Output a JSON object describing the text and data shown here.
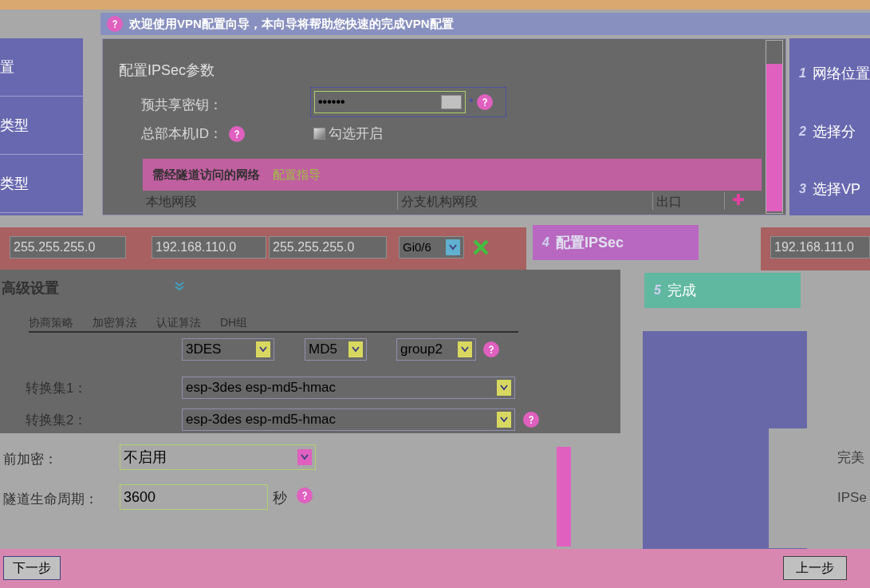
{
  "window": {
    "title": "欢迎使用VPN配置向导，本向导将帮助您快速的完成VPN配置"
  },
  "sidebar": {
    "items": [
      {
        "label": "置"
      },
      {
        "label": "类型"
      },
      {
        "label": "类型"
      }
    ]
  },
  "form": {
    "heading": "配置IPSec参数",
    "psk_label": "预共享密钥：",
    "psk_value": "••••••",
    "required_mark": "*",
    "id_label": "总部本机ID：",
    "id_checkbox": {
      "label": "勾选开启",
      "checked": false
    }
  },
  "networks": {
    "title": "需经隧道访问的网络",
    "link": "配置指导",
    "columns": [
      "本地网段",
      "分支机构网段",
      "出口"
    ],
    "row": {
      "local_mask": "255.255.255.0",
      "branch_net": "192.168.110.0",
      "branch_mask": "255.255.255.0",
      "port": "Gi0/6"
    }
  },
  "steps": [
    {
      "number": "1",
      "label": "网络位置",
      "selected": false
    },
    {
      "number": "2",
      "label": "选择分",
      "selected": false
    },
    {
      "number": "3",
      "label": "选择VP",
      "selected": false
    },
    {
      "number": "4",
      "label": "配置IPSec",
      "selected": true
    },
    {
      "number": "5",
      "label": "完成",
      "selected": false
    }
  ],
  "side_field": "192.168.111.0",
  "advanced": {
    "title": "高级设置",
    "columns": [
      "协商策略",
      "加密算法",
      "认证算法",
      "DH组"
    ],
    "encryption": "3DES",
    "hash": "MD5",
    "group": "group2",
    "transform_sets": [
      {
        "label": "转换集1：",
        "value": "esp-3des esp-md5-hmac"
      },
      {
        "label": "转换集2：",
        "value": "esp-3des esp-md5-hmac"
      }
    ],
    "pfs_label": "前加密：",
    "pfs_value": "不启用",
    "lifetime_label": "隧道生命周期：",
    "lifetime_value": "3600",
    "lifetime_unit": "秒"
  },
  "right_labels": [
    "完美",
    "IPSe"
  ],
  "buttons": {
    "next": "下一步",
    "prev": "上一步"
  }
}
